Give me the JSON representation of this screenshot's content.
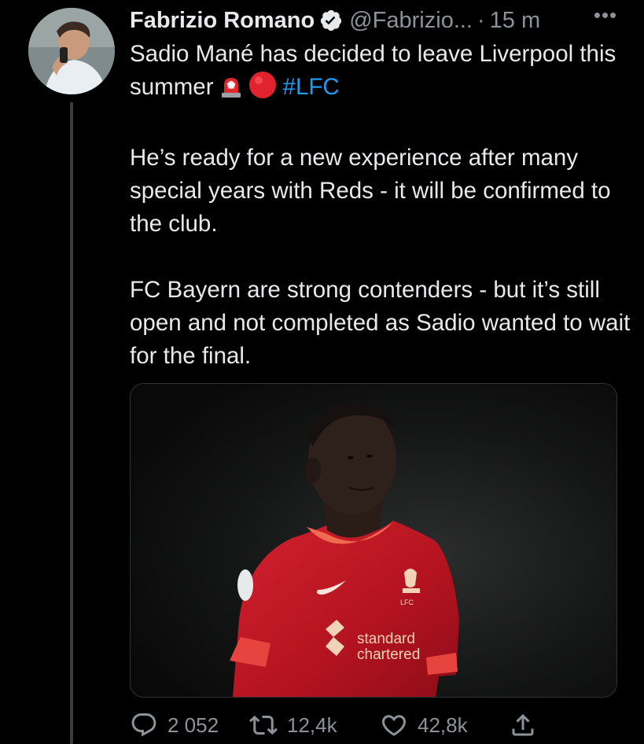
{
  "tweet": {
    "author": {
      "name": "Fabrizio Romano",
      "handle": "@Fabrizio...",
      "time": "15 m",
      "separator": "·"
    },
    "more_label": "•••",
    "text": {
      "p1": "Sadio Mané has decided to leave Liverpool this summer",
      "hashtag": "#LFC",
      "p2": "He’s ready for a new experience after many special years with Reds - it will be confirmed to the club.",
      "p3": "FC Bayern are strong contenders - but it’s still open and not completed as Sadio wanted to wait for the final."
    },
    "media": {
      "shirt_text_1": "standard",
      "shirt_text_2": "chartered",
      "badge_text": "LFC"
    },
    "actions": {
      "replies": "2 052",
      "retweets": "12,4k",
      "likes": "42,8k"
    }
  },
  "colors": {
    "background": "#000000",
    "text": "#e7e9ea",
    "muted": "#8b9298",
    "link": "#1d9bf0",
    "jersey": "#c8102e"
  },
  "icons": [
    "verified-badge-icon",
    "more-icon",
    "siren-emoji-icon",
    "red-circle-emoji-icon",
    "reply-icon",
    "retweet-icon",
    "like-icon",
    "share-icon"
  ]
}
